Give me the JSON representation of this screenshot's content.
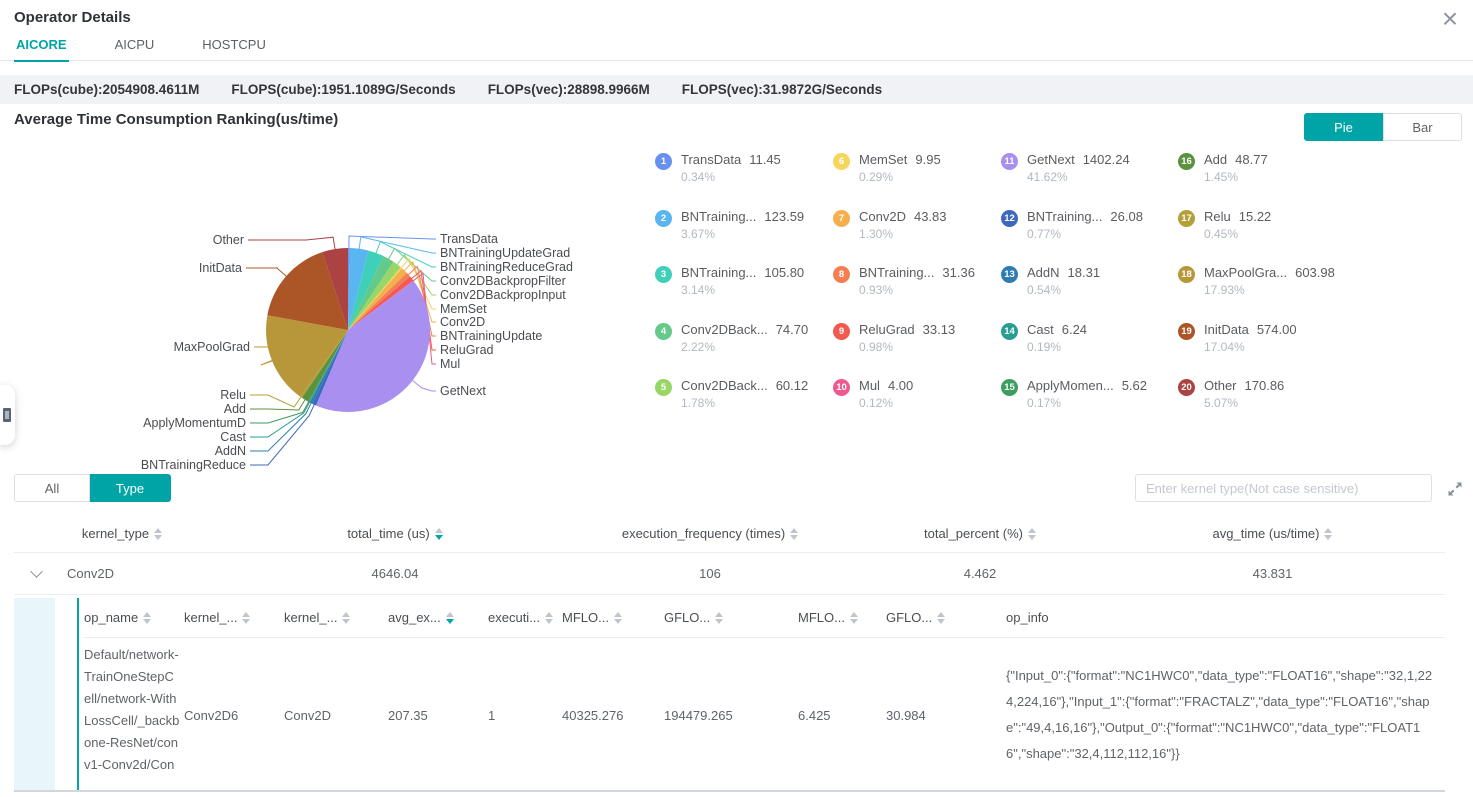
{
  "window": {
    "title": "Operator Details"
  },
  "tabs": [
    {
      "label": "AICORE",
      "active": true
    },
    {
      "label": "AICPU",
      "active": false
    },
    {
      "label": "HOSTCPU",
      "active": false
    }
  ],
  "flops_bar": {
    "items": [
      "FLOPs(cube):2054908.4611M",
      "FLOPS(cube):1951.1089G/Seconds",
      "FLOPs(vec):28898.9966M",
      "FLOPS(vec):31.9872G/Seconds"
    ]
  },
  "ranking": {
    "title": "Average Time Consumption Ranking(us/time)",
    "chart_modes": [
      {
        "label": "Pie",
        "active": true
      },
      {
        "label": "Bar",
        "active": false
      }
    ]
  },
  "chart_data": {
    "type": "pie",
    "title": "Average Time Consumption Ranking(us/time)",
    "value_unit": "us/time",
    "legend_position": "right",
    "items": [
      {
        "rank": 1,
        "name": "TransData",
        "legend_label": "TransData",
        "avg_time_us": "11.45",
        "percent": "0.34%",
        "color": "#6791F0"
      },
      {
        "rank": 2,
        "name": "BNTrainingUpdateGrad",
        "legend_label": "BNTraining...",
        "avg_time_us": "123.59",
        "percent": "3.67%",
        "color": "#5AB6F0"
      },
      {
        "rank": 3,
        "name": "BNTrainingReduceGrad",
        "legend_label": "BNTraining...",
        "avg_time_us": "105.80",
        "percent": "3.14%",
        "color": "#40D0B9"
      },
      {
        "rank": 4,
        "name": "Conv2DBackpropFilter",
        "legend_label": "Conv2DBack...",
        "avg_time_us": "74.70",
        "percent": "2.22%",
        "color": "#65C98A"
      },
      {
        "rank": 5,
        "name": "Conv2DBackpropInput",
        "legend_label": "Conv2DBack...",
        "avg_time_us": "60.12",
        "percent": "1.78%",
        "color": "#97D667"
      },
      {
        "rank": 6,
        "name": "MemSet",
        "legend_label": "MemSet",
        "avg_time_us": "9.95",
        "percent": "0.29%",
        "color": "#F5D65D"
      },
      {
        "rank": 7,
        "name": "Conv2D",
        "legend_label": "Conv2D",
        "avg_time_us": "43.83",
        "percent": "1.30%",
        "color": "#F5B04E"
      },
      {
        "rank": 8,
        "name": "BNTrainingUpdate",
        "legend_label": "BNTraining...",
        "avg_time_us": "31.36",
        "percent": "0.93%",
        "color": "#F57F55"
      },
      {
        "rank": 9,
        "name": "ReluGrad",
        "legend_label": "ReluGrad",
        "avg_time_us": "33.13",
        "percent": "0.98%",
        "color": "#F25950"
      },
      {
        "rank": 10,
        "name": "Mul",
        "legend_label": "Mul",
        "avg_time_us": "4.00",
        "percent": "0.12%",
        "color": "#EE5A90"
      },
      {
        "rank": 11,
        "name": "GetNext",
        "legend_label": "GetNext",
        "avg_time_us": "1402.24",
        "percent": "41.62%",
        "color": "#A98FF0"
      },
      {
        "rank": 12,
        "name": "BNTrainingReduce",
        "legend_label": "BNTraining...",
        "avg_time_us": "26.08",
        "percent": "0.77%",
        "color": "#3C68BE"
      },
      {
        "rank": 13,
        "name": "AddN",
        "legend_label": "AddN",
        "avg_time_us": "18.31",
        "percent": "0.54%",
        "color": "#2E7CB3"
      },
      {
        "rank": 14,
        "name": "Cast",
        "legend_label": "Cast",
        "avg_time_us": "6.24",
        "percent": "0.19%",
        "color": "#289E92"
      },
      {
        "rank": 15,
        "name": "ApplyMomentumD",
        "legend_label": "ApplyMomen...",
        "avg_time_us": "5.62",
        "percent": "0.17%",
        "color": "#3D9E61"
      },
      {
        "rank": 16,
        "name": "Add",
        "legend_label": "Add",
        "avg_time_us": "48.77",
        "percent": "1.45%",
        "color": "#5A923D"
      },
      {
        "rank": 17,
        "name": "Relu",
        "legend_label": "Relu",
        "avg_time_us": "15.22",
        "percent": "0.45%",
        "color": "#B3A038"
      },
      {
        "rank": 18,
        "name": "MaxPoolGrad",
        "legend_label": "MaxPoolGra...",
        "avg_time_us": "603.98",
        "percent": "17.93%",
        "color": "#B8973B"
      },
      {
        "rank": 19,
        "name": "InitData",
        "legend_label": "InitData",
        "avg_time_us": "574.00",
        "percent": "17.04%",
        "color": "#AC5527"
      },
      {
        "rank": 20,
        "name": "Other",
        "legend_label": "Other",
        "avg_time_us": "170.86",
        "percent": "5.07%",
        "color": "#AC4242"
      }
    ]
  },
  "filter": {
    "buttons": [
      {
        "label": "All",
        "active": false
      },
      {
        "label": "Type",
        "active": true
      }
    ],
    "search_placeholder": "Enter kernel type(Not case sensitive)"
  },
  "kernel_table": {
    "headers": [
      {
        "label": "kernel_type",
        "sort": "none"
      },
      {
        "label": "total_time (us)",
        "sort": "desc"
      },
      {
        "label": "execution_frequency (times)",
        "sort": "none"
      },
      {
        "label": "total_percent (%)",
        "sort": "none"
      },
      {
        "label": "avg_time (us/time)",
        "sort": "none"
      }
    ],
    "rows": [
      {
        "kernel_type": "Conv2D",
        "total_time_us": "4646.04",
        "execution_frequency": "106",
        "total_percent": "4.462",
        "avg_time": "43.831",
        "expanded": true
      }
    ]
  },
  "detail_table": {
    "headers": [
      {
        "label": "op_name",
        "sort": "none"
      },
      {
        "label": "kernel_...",
        "sort": "none"
      },
      {
        "label": "kernel_...",
        "sort": "none"
      },
      {
        "label": "avg_ex...",
        "sort": "desc"
      },
      {
        "label": "executi...",
        "sort": "none"
      },
      {
        "label": "MFLO...",
        "sort": "none"
      },
      {
        "label": "GFLO...",
        "sort": "none"
      },
      {
        "label": "MFLO...",
        "sort": "none"
      },
      {
        "label": "GFLO...",
        "sort": "none"
      },
      {
        "label": "op_info",
        "sort": null
      }
    ],
    "rows": [
      {
        "op_name": "Default/network-TrainOneStepCell/network-WithLossCell/_backbone-ResNet/conv1-Conv2d/Con",
        "kernel_name": "Conv2D6",
        "kernel_type": "Conv2D",
        "avg_execution_time": "207.35",
        "execution_frequency": "1",
        "mflops": "40325.276",
        "gflops_per_second": "194479.265",
        "mflops_2": "6.425",
        "gflops_per_second_2": "30.984",
        "op_info": "{\"Input_0\":{\"format\":\"NC1HWC0\",\"data_type\":\"FLOAT16\",\"shape\":\"32,1,224,224,16\"},\"Input_1\":{\"format\":\"FRACTALZ\",\"data_type\":\"FLOAT16\",\"shape\":\"49,4,16,16\"},\"Output_0\":{\"format\":\"NC1HWC0\",\"data_type\":\"FLOAT16\",\"shape\":\"32,4,112,112,16\"}}"
      }
    ]
  }
}
